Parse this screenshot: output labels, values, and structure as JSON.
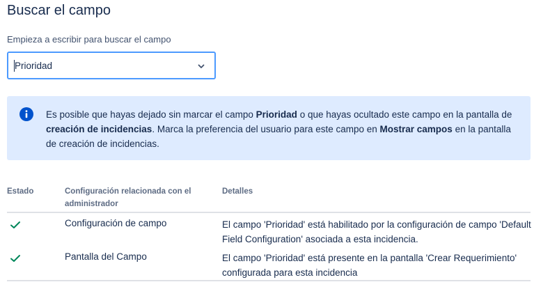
{
  "page": {
    "title": "Buscar el campo"
  },
  "search": {
    "label": "Empieza a escribir para buscar el campo",
    "value": "Prioridad"
  },
  "info": {
    "t1": "Es posible que hayas dejado sin marcar el campo ",
    "b1": "Prioridad",
    "t2": " o que hayas ocultado este campo en la pantalla de ",
    "b2": "creación de incidencias",
    "t3": ". Marca la preferencia del usuario para este campo en ",
    "b3": "Mostrar campos",
    "t4": " en la pantalla de creación de incidencias."
  },
  "table": {
    "headers": {
      "estado": "Estado",
      "config": "Configuración relacionada con el administrador",
      "detalles": "Detalles"
    },
    "rows": [
      {
        "status": "ok",
        "config": "Configuración de campo",
        "detail": "El campo 'Prioridad' está habilitado por la configuración de campo 'Default Field Configuration' asociada a esta incidencia."
      },
      {
        "status": "ok",
        "config": "Pantalla del Campo",
        "detail": "El campo 'Prioridad' está presente en la pantalla 'Crear Requerimiento' configurada para esta incidencia"
      }
    ]
  },
  "colors": {
    "accent": "#4c9aff",
    "info_bg": "#deebff",
    "info_icon": "#0052cc",
    "success": "#00875a"
  },
  "icons": {
    "dropdown": "chevron-down-icon",
    "info": "info-icon",
    "status_ok": "check-icon"
  }
}
